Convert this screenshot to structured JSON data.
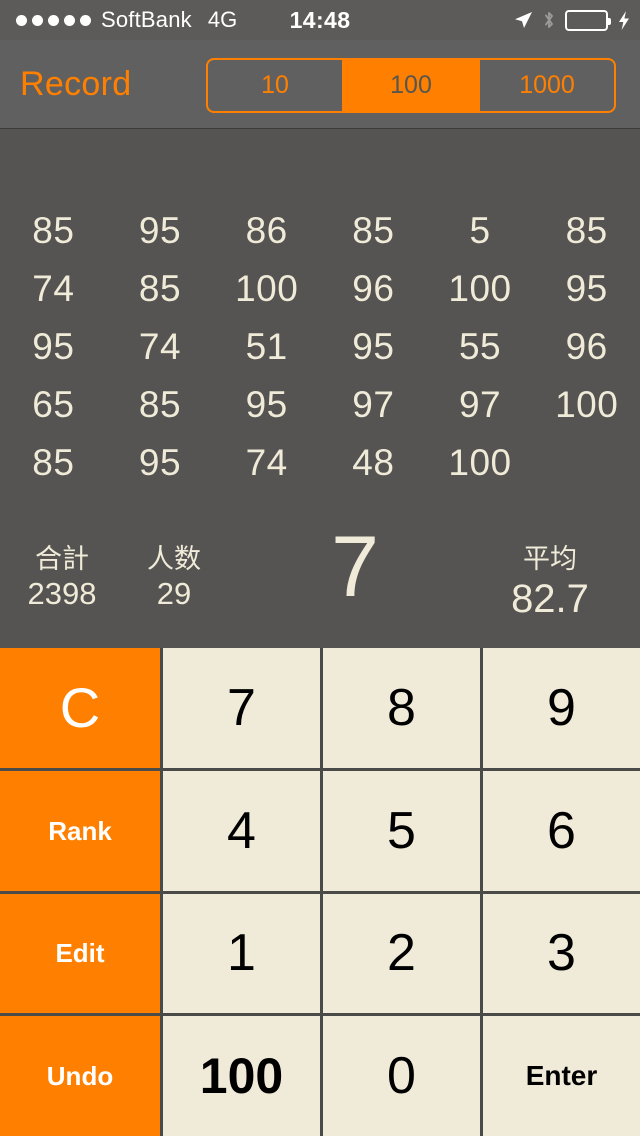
{
  "status_bar": {
    "signal_dots": 5,
    "carrier": "SoftBank",
    "network": "4G",
    "time": "14:48",
    "icons": [
      "location-arrow-icon",
      "bluetooth-icon",
      "battery-icon",
      "charging-bolt-icon"
    ],
    "battery_color": "#4CD964"
  },
  "nav": {
    "title": "Record",
    "accent_color": "#FF8000",
    "segments": [
      {
        "label": "10",
        "selected": false
      },
      {
        "label": "100",
        "selected": true
      },
      {
        "label": "1000",
        "selected": false
      }
    ]
  },
  "records": {
    "rows": [
      [
        "85",
        "95",
        "86",
        "85",
        "5",
        "85"
      ],
      [
        "74",
        "85",
        "100",
        "96",
        "100",
        "95"
      ],
      [
        "95",
        "74",
        "51",
        "95",
        "55",
        "96"
      ],
      [
        "65",
        "85",
        "95",
        "97",
        "97",
        "100"
      ],
      [
        "85",
        "95",
        "74",
        "48",
        "100",
        ""
      ]
    ],
    "text_color": "#F0EBD8",
    "background": "#555452"
  },
  "stats": {
    "total_label": "合計",
    "total_value": "2398",
    "count_label": "人数",
    "count_value": "29",
    "average_label": "平均",
    "average_value": "82.7",
    "display_value": "7"
  },
  "keypad": {
    "function_color": "#FF8000",
    "key_color": "#F0EBD8",
    "rows": [
      [
        {
          "label": "C",
          "type": "function",
          "style": "clear"
        },
        {
          "label": "7",
          "type": "number",
          "style": "digit"
        },
        {
          "label": "8",
          "type": "number",
          "style": "digit"
        },
        {
          "label": "9",
          "type": "number",
          "style": "digit"
        }
      ],
      [
        {
          "label": "Rank",
          "type": "function",
          "style": "small"
        },
        {
          "label": "4",
          "type": "number",
          "style": "digit"
        },
        {
          "label": "5",
          "type": "number",
          "style": "digit"
        },
        {
          "label": "6",
          "type": "number",
          "style": "digit"
        }
      ],
      [
        {
          "label": "Edit",
          "type": "function",
          "style": "small"
        },
        {
          "label": "1",
          "type": "number",
          "style": "digit"
        },
        {
          "label": "2",
          "type": "number",
          "style": "digit"
        },
        {
          "label": "3",
          "type": "number",
          "style": "digit"
        }
      ],
      [
        {
          "label": "Undo",
          "type": "function",
          "style": "small"
        },
        {
          "label": "100",
          "type": "number",
          "style": "wide-txt"
        },
        {
          "label": "0",
          "type": "number",
          "style": "digit"
        },
        {
          "label": "Enter",
          "type": "number",
          "style": "enter"
        }
      ]
    ]
  }
}
